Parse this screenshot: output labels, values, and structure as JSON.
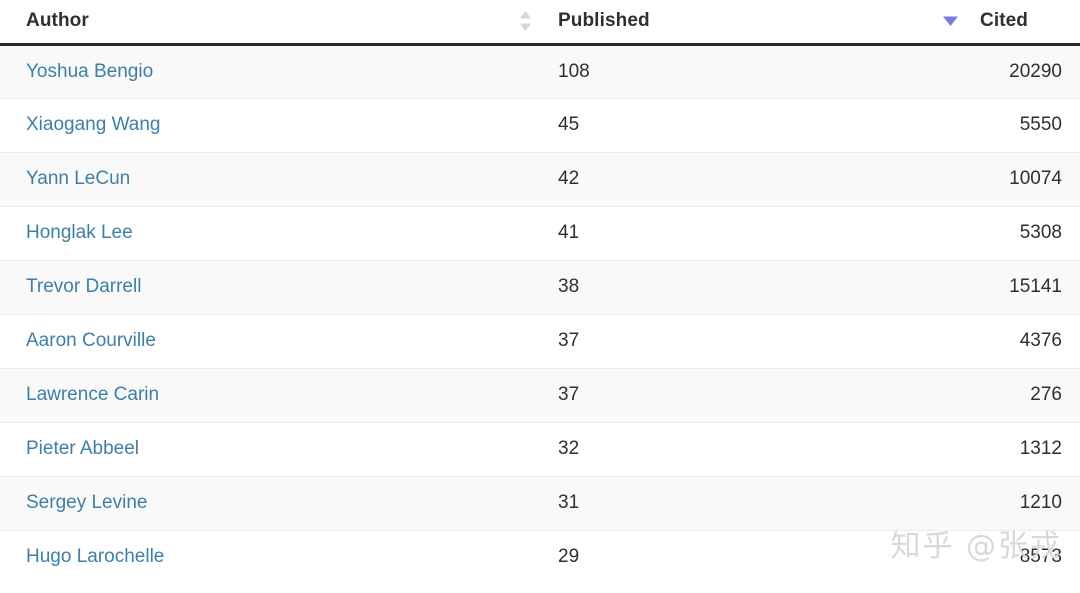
{
  "table": {
    "columns": [
      {
        "key": "author",
        "label": "Author",
        "align": "left"
      },
      {
        "key": "published",
        "label": "Published",
        "align": "left"
      },
      {
        "key": "cited",
        "label": "Cited",
        "align": "right"
      }
    ],
    "sort_controls": {
      "published": {
        "icon": "sort-both-icon",
        "state": "unsorted",
        "color": "#d3d3d3"
      },
      "cited": {
        "icon": "sort-desc-icon",
        "state": "descending",
        "color": "#7b7ce0"
      }
    },
    "link_color": "#3d7fa8",
    "stripe_color": "#f9f9f9",
    "row_border_color": "#ececec",
    "header_border_color": "#2b2b2b",
    "rows": [
      {
        "author": "Yoshua Bengio",
        "published": "108",
        "cited": "20290"
      },
      {
        "author": "Xiaogang Wang",
        "published": "45",
        "cited": "5550"
      },
      {
        "author": "Yann LeCun",
        "published": "42",
        "cited": "10074"
      },
      {
        "author": "Honglak Lee",
        "published": "41",
        "cited": "5308"
      },
      {
        "author": "Trevor Darrell",
        "published": "38",
        "cited": "15141"
      },
      {
        "author": "Aaron Courville",
        "published": "37",
        "cited": "4376"
      },
      {
        "author": "Lawrence Carin",
        "published": "37",
        "cited": "276"
      },
      {
        "author": "Pieter Abbeel",
        "published": "32",
        "cited": "1312"
      },
      {
        "author": "Sergey Levine",
        "published": "31",
        "cited": "1210"
      },
      {
        "author": "Hugo Larochelle",
        "published": "29",
        "cited": "8573"
      }
    ]
  },
  "watermark": {
    "text": "知乎 @张戎",
    "color": "#d9d9d9"
  }
}
